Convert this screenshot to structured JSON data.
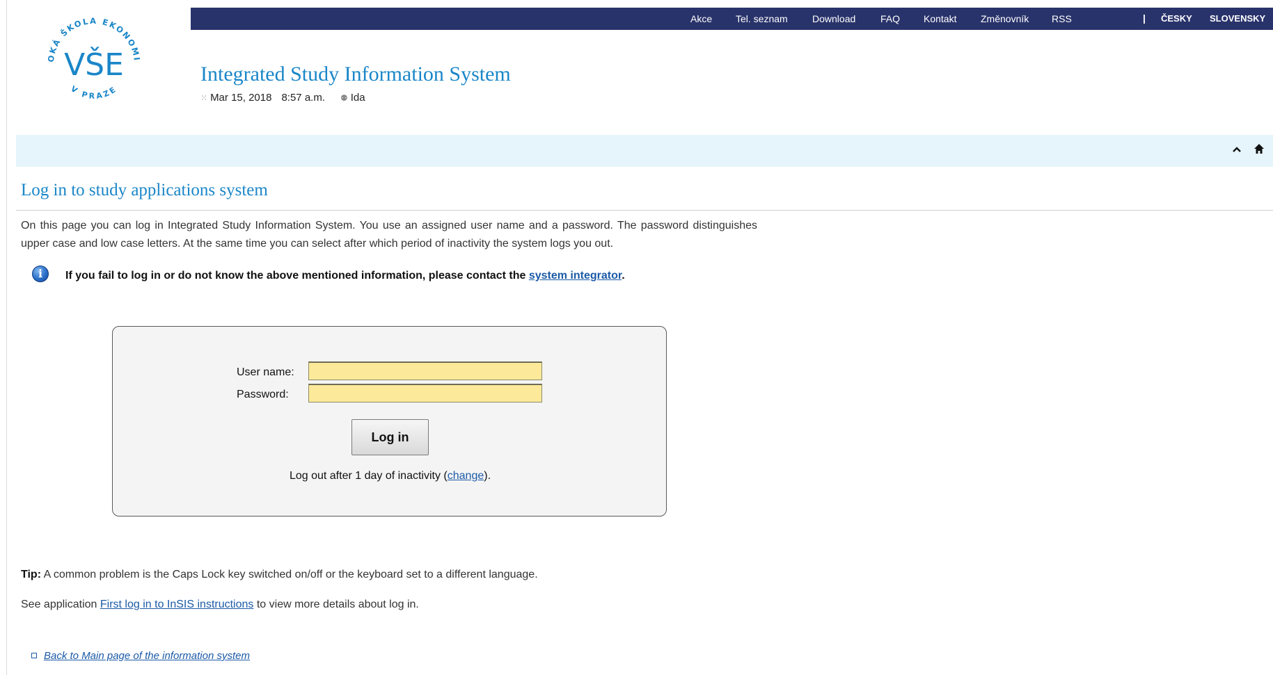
{
  "logo": {
    "ring_text": "VYSOKÁ ŠKOLA EKONOMICKÁ",
    "bottom_text": "V PRAZE",
    "mark": "VŠE",
    "color": "#1a86c8"
  },
  "nav": {
    "items": [
      "Akce",
      "Tel. seznam",
      "Download",
      "FAQ",
      "Kontakt",
      "Změnovník",
      "RSS"
    ],
    "separator": "|",
    "languages": [
      "ČESKY",
      "SLOVENSKY"
    ],
    "background": "#29336b"
  },
  "header": {
    "title": "Integrated Study Information System",
    "date": "Mar 15, 2018",
    "time": "8:57 a.m.",
    "user": "Ida",
    "date_icon": "clock-dots-icon",
    "user_icon": "person-icon"
  },
  "toolbar": {
    "icons": [
      "chevron-up-icon",
      "home-icon"
    ]
  },
  "page": {
    "title": "Log in to study applications system",
    "intro": "On this page you can log in Integrated Study Information System. You use an assigned user name and a password. The password distinguishes upper case and low case letters. At the same time you can select after which period of inactivity the system logs you out.",
    "info": {
      "icon": "info-icon",
      "text_before": "If you fail to log in or do not know the above mentioned information, please contact the",
      "link": "system integrator",
      "text_after": "."
    }
  },
  "login": {
    "username_label": "User name:",
    "username_value": "",
    "password_label": "Password:",
    "password_value": "",
    "button": "Log in",
    "logout_before": "Log out after 1 day of inactivity (",
    "logout_link": "change",
    "logout_after": ")."
  },
  "tip": {
    "label": "Tip:",
    "text": "A common problem is the Caps Lock key switched on/off or the keyboard set to a different language."
  },
  "see": {
    "before": "See application",
    "link": "First log in to InSIS instructions",
    "after": "to view more details about log in."
  },
  "back": {
    "link": "Back to Main page of the information system"
  },
  "colors": {
    "accent": "#1a86c8",
    "link": "#1b5aa6",
    "band": "#e6f5fb",
    "input": "#fde99a"
  }
}
